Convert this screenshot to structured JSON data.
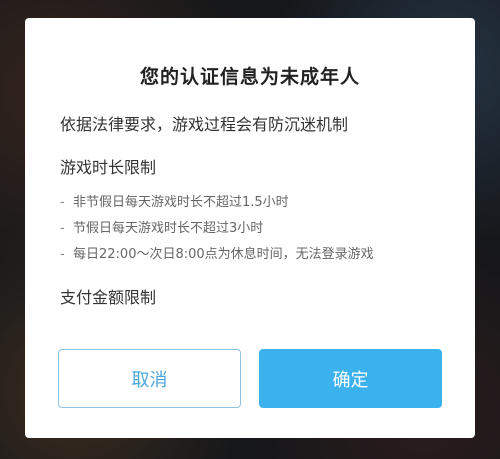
{
  "dialog": {
    "title": "您的认证信息为未成年人",
    "intro": "依据法律要求，游戏过程会有防沉迷机制",
    "play_time_section": "游戏时长限制",
    "rules": [
      "非节假日每天游戏时长不超过1.5小时",
      "节假日每天游戏时长不超过3小时",
      "每日22:00～次日8:00点为休息时间，无法登录游戏"
    ],
    "rule_bullet": "-",
    "payment_section": "支付金额限制",
    "cancel_label": "取消",
    "confirm_label": "确定"
  },
  "colors": {
    "accent": "#3bb1ee",
    "cancel_border": "#8fc3e3",
    "cancel_text": "#4aa7dc"
  }
}
